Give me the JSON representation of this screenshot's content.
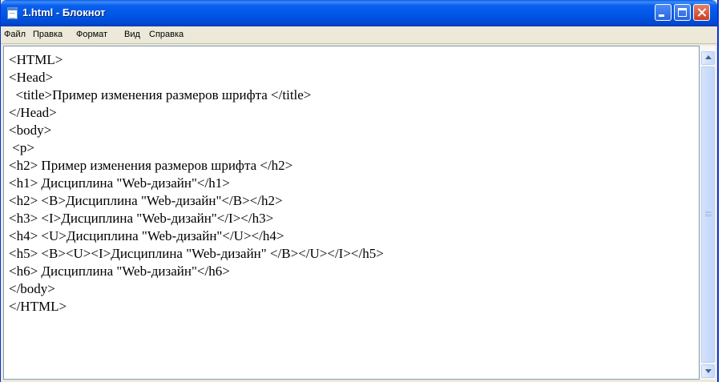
{
  "window": {
    "title": "1.html - Блокнот"
  },
  "menubar": {
    "items": [
      "Файл",
      "Правка",
      "Формат",
      "Вид",
      "Справка"
    ]
  },
  "editor": {
    "lines": [
      "<HTML>",
      "<Head>",
      "  <title>Пример изменения размеров шрифта </title>",
      "</Head>",
      "<body>",
      " <p>",
      "<h2> Пример изменения размеров шрифта </h2>",
      "<h1> Дисциплина \"Web-дизайн\"</h1>",
      "<h2> <B>Дисциплина \"Web-дизайн\"</B></h2>",
      "<h3> <I>Дисциплина \"Web-дизайн\"</I></h3>",
      "<h4> <U>Дисциплина \"Web-дизайн\"</U></h4>",
      "<h5> <B><U><I>Дисциплина \"Web-дизайн\" </B></U></I></h5>",
      "<h6> Дисциплина \"Web-дизайн\"</h6>",
      "</body>",
      "</HTML>"
    ]
  },
  "icons": {
    "app": "notepad-icon",
    "minimize": "minimize-icon",
    "maximize": "maximize-icon",
    "close": "close-icon",
    "scroll_up": "arrow-up-icon",
    "scroll_down": "arrow-down-icon"
  },
  "colors": {
    "titlebar": "#0055e5",
    "close_button": "#c8401f",
    "editor_bg": "#ffffff",
    "chrome": "#ece9d8"
  }
}
